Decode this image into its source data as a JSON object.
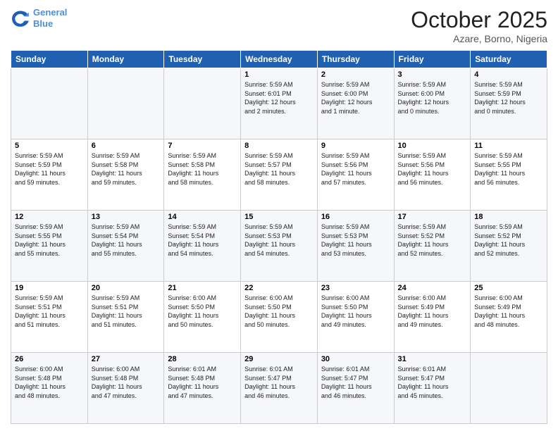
{
  "header": {
    "logo_line1": "General",
    "logo_line2": "Blue",
    "title": "October 2025",
    "subtitle": "Azare, Borno, Nigeria"
  },
  "weekdays": [
    "Sunday",
    "Monday",
    "Tuesday",
    "Wednesday",
    "Thursday",
    "Friday",
    "Saturday"
  ],
  "weeks": [
    [
      {
        "day": "",
        "content": ""
      },
      {
        "day": "",
        "content": ""
      },
      {
        "day": "",
        "content": ""
      },
      {
        "day": "1",
        "content": "Sunrise: 5:59 AM\nSunset: 6:01 PM\nDaylight: 12 hours\nand 2 minutes."
      },
      {
        "day": "2",
        "content": "Sunrise: 5:59 AM\nSunset: 6:00 PM\nDaylight: 12 hours\nand 1 minute."
      },
      {
        "day": "3",
        "content": "Sunrise: 5:59 AM\nSunset: 6:00 PM\nDaylight: 12 hours\nand 0 minutes."
      },
      {
        "day": "4",
        "content": "Sunrise: 5:59 AM\nSunset: 5:59 PM\nDaylight: 12 hours\nand 0 minutes."
      }
    ],
    [
      {
        "day": "5",
        "content": "Sunrise: 5:59 AM\nSunset: 5:59 PM\nDaylight: 11 hours\nand 59 minutes."
      },
      {
        "day": "6",
        "content": "Sunrise: 5:59 AM\nSunset: 5:58 PM\nDaylight: 11 hours\nand 59 minutes."
      },
      {
        "day": "7",
        "content": "Sunrise: 5:59 AM\nSunset: 5:58 PM\nDaylight: 11 hours\nand 58 minutes."
      },
      {
        "day": "8",
        "content": "Sunrise: 5:59 AM\nSunset: 5:57 PM\nDaylight: 11 hours\nand 58 minutes."
      },
      {
        "day": "9",
        "content": "Sunrise: 5:59 AM\nSunset: 5:56 PM\nDaylight: 11 hours\nand 57 minutes."
      },
      {
        "day": "10",
        "content": "Sunrise: 5:59 AM\nSunset: 5:56 PM\nDaylight: 11 hours\nand 56 minutes."
      },
      {
        "day": "11",
        "content": "Sunrise: 5:59 AM\nSunset: 5:55 PM\nDaylight: 11 hours\nand 56 minutes."
      }
    ],
    [
      {
        "day": "12",
        "content": "Sunrise: 5:59 AM\nSunset: 5:55 PM\nDaylight: 11 hours\nand 55 minutes."
      },
      {
        "day": "13",
        "content": "Sunrise: 5:59 AM\nSunset: 5:54 PM\nDaylight: 11 hours\nand 55 minutes."
      },
      {
        "day": "14",
        "content": "Sunrise: 5:59 AM\nSunset: 5:54 PM\nDaylight: 11 hours\nand 54 minutes."
      },
      {
        "day": "15",
        "content": "Sunrise: 5:59 AM\nSunset: 5:53 PM\nDaylight: 11 hours\nand 54 minutes."
      },
      {
        "day": "16",
        "content": "Sunrise: 5:59 AM\nSunset: 5:53 PM\nDaylight: 11 hours\nand 53 minutes."
      },
      {
        "day": "17",
        "content": "Sunrise: 5:59 AM\nSunset: 5:52 PM\nDaylight: 11 hours\nand 52 minutes."
      },
      {
        "day": "18",
        "content": "Sunrise: 5:59 AM\nSunset: 5:52 PM\nDaylight: 11 hours\nand 52 minutes."
      }
    ],
    [
      {
        "day": "19",
        "content": "Sunrise: 5:59 AM\nSunset: 5:51 PM\nDaylight: 11 hours\nand 51 minutes."
      },
      {
        "day": "20",
        "content": "Sunrise: 5:59 AM\nSunset: 5:51 PM\nDaylight: 11 hours\nand 51 minutes."
      },
      {
        "day": "21",
        "content": "Sunrise: 6:00 AM\nSunset: 5:50 PM\nDaylight: 11 hours\nand 50 minutes."
      },
      {
        "day": "22",
        "content": "Sunrise: 6:00 AM\nSunset: 5:50 PM\nDaylight: 11 hours\nand 50 minutes."
      },
      {
        "day": "23",
        "content": "Sunrise: 6:00 AM\nSunset: 5:50 PM\nDaylight: 11 hours\nand 49 minutes."
      },
      {
        "day": "24",
        "content": "Sunrise: 6:00 AM\nSunset: 5:49 PM\nDaylight: 11 hours\nand 49 minutes."
      },
      {
        "day": "25",
        "content": "Sunrise: 6:00 AM\nSunset: 5:49 PM\nDaylight: 11 hours\nand 48 minutes."
      }
    ],
    [
      {
        "day": "26",
        "content": "Sunrise: 6:00 AM\nSunset: 5:48 PM\nDaylight: 11 hours\nand 48 minutes."
      },
      {
        "day": "27",
        "content": "Sunrise: 6:00 AM\nSunset: 5:48 PM\nDaylight: 11 hours\nand 47 minutes."
      },
      {
        "day": "28",
        "content": "Sunrise: 6:01 AM\nSunset: 5:48 PM\nDaylight: 11 hours\nand 47 minutes."
      },
      {
        "day": "29",
        "content": "Sunrise: 6:01 AM\nSunset: 5:47 PM\nDaylight: 11 hours\nand 46 minutes."
      },
      {
        "day": "30",
        "content": "Sunrise: 6:01 AM\nSunset: 5:47 PM\nDaylight: 11 hours\nand 46 minutes."
      },
      {
        "day": "31",
        "content": "Sunrise: 6:01 AM\nSunset: 5:47 PM\nDaylight: 11 hours\nand 45 minutes."
      },
      {
        "day": "",
        "content": ""
      }
    ]
  ]
}
